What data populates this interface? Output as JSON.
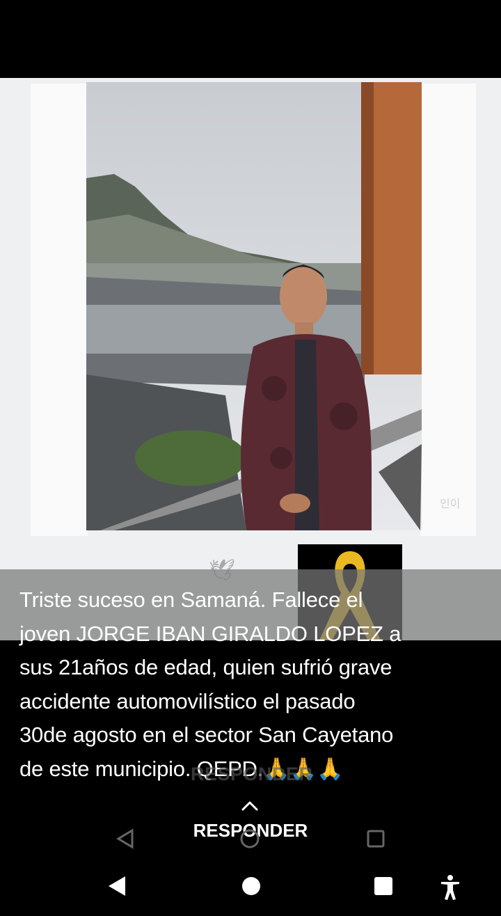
{
  "story": {
    "caption": "Triste suceso en Samaná. Fallece el\njoven JORGE IBAN GIRALDO LOPEZ a\nsus 21años de edad, quien sufrió grave\naccidente automovilístico el pasado\n30de agosto en el sector San Cayetano\nde este municipio. QEPD.🙏🙏🙏",
    "watermark": "인이",
    "reply_label": "RESPONDER",
    "reply_label_ghost": "RESPONDER"
  },
  "icons": {
    "reply": "chevron-up-icon",
    "memorial": "yellow-ribbon-icon",
    "decor": "dove-icon",
    "nav_back": "triangle-back-icon",
    "nav_home": "circle-home-icon",
    "nav_recent": "square-recents-icon",
    "nav_accessibility": "accessibility-person-icon"
  },
  "colors": {
    "ribbon": "#e8b923",
    "caption_overlay": "#787878",
    "background": "#000000"
  }
}
